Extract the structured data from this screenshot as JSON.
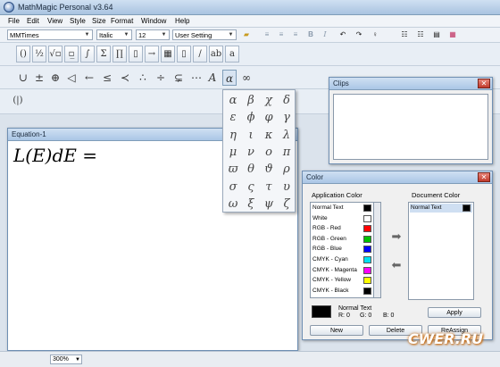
{
  "window": {
    "title": "MathMagic Personal v3.64"
  },
  "menu": [
    "File",
    "Edit",
    "View",
    "Style",
    "Size",
    "Format",
    "Window",
    "Help"
  ],
  "format_bar": {
    "font": "MMTimes",
    "style": "Italic",
    "size": "12",
    "setting": "User Setting",
    "bold": "B",
    "italic": "I"
  },
  "template_buttons": [
    "()",
    "½",
    "√▫",
    "▫̲",
    "∫",
    "Σ",
    "∏",
    "▯",
    "→",
    "▦",
    "▯",
    "/",
    "ab",
    "a"
  ],
  "symbol_buttons": [
    "∪",
    "±",
    "⊕",
    "◁",
    "←",
    "≤",
    "≺",
    "∴",
    "÷",
    "⊊",
    "⋯",
    "A",
    "α",
    "∞"
  ],
  "row_button": "(|)",
  "greek_palette": [
    "α",
    "β",
    "χ",
    "δ",
    "ε",
    "ϕ",
    "φ",
    "γ",
    "η",
    "ι",
    "κ",
    "λ",
    "μ",
    "ν",
    "ο",
    "π",
    "ϖ",
    "θ",
    "ϑ",
    "ρ",
    "σ",
    "ς",
    "τ",
    "υ",
    "ω",
    "ξ",
    "ψ",
    "ζ"
  ],
  "equation_window": {
    "title": "Equation-1",
    "content": "L(E)dE ="
  },
  "clips_window": {
    "title": "Clips"
  },
  "color_window": {
    "title": "Color",
    "app_label": "Application Color",
    "doc_label": "Document Color",
    "app_colors": [
      {
        "name": "Normal Text",
        "color": "#000000"
      },
      {
        "name": "White",
        "color": "#ffffff"
      },
      {
        "name": "RGB - Red",
        "color": "#ff0000"
      },
      {
        "name": "RGB - Green",
        "color": "#00c000"
      },
      {
        "name": "RGB - Blue",
        "color": "#0000ff"
      },
      {
        "name": "CMYK - Cyan",
        "color": "#00e0f0"
      },
      {
        "name": "CMYK - Magenta",
        "color": "#ff00ff"
      },
      {
        "name": "CMYK - Yellow",
        "color": "#ffff00"
      },
      {
        "name": "CMYK - Black",
        "color": "#000000"
      }
    ],
    "doc_colors": [
      {
        "name": "Normal Text",
        "color": "#000000"
      }
    ],
    "selected_name": "Normal Text",
    "r": "R: 0",
    "g": "G: 0",
    "b": "B: 0",
    "apply": "Apply",
    "new": "New",
    "delete": "Delete",
    "reassign": "ReAssign"
  },
  "status": {
    "zoom": "300%"
  },
  "watermark": "CWER.RU"
}
